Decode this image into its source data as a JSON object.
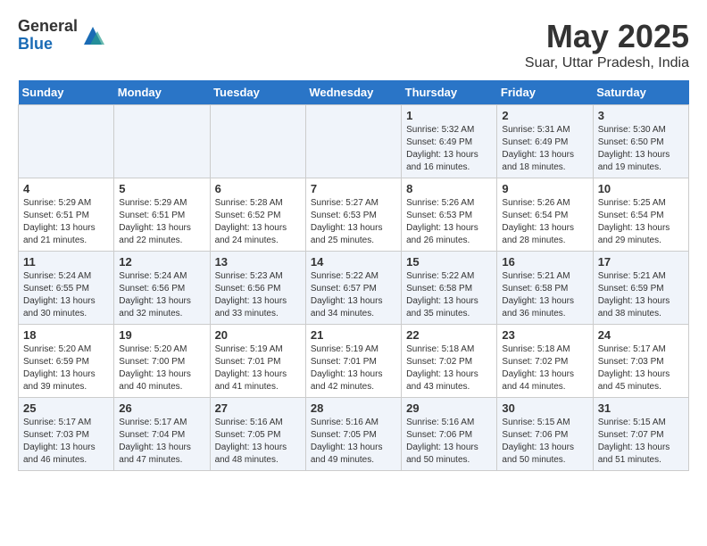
{
  "logo": {
    "general": "General",
    "blue": "Blue"
  },
  "title": "May 2025",
  "subtitle": "Suar, Uttar Pradesh, India",
  "days_of_week": [
    "Sunday",
    "Monday",
    "Tuesday",
    "Wednesday",
    "Thursday",
    "Friday",
    "Saturday"
  ],
  "weeks": [
    {
      "cells": [
        {
          "day": "",
          "info": ""
        },
        {
          "day": "",
          "info": ""
        },
        {
          "day": "",
          "info": ""
        },
        {
          "day": "",
          "info": ""
        },
        {
          "day": "1",
          "info": "Sunrise: 5:32 AM\nSunset: 6:49 PM\nDaylight: 13 hours\nand 16 minutes."
        },
        {
          "day": "2",
          "info": "Sunrise: 5:31 AM\nSunset: 6:49 PM\nDaylight: 13 hours\nand 18 minutes."
        },
        {
          "day": "3",
          "info": "Sunrise: 5:30 AM\nSunset: 6:50 PM\nDaylight: 13 hours\nand 19 minutes."
        }
      ]
    },
    {
      "cells": [
        {
          "day": "4",
          "info": "Sunrise: 5:29 AM\nSunset: 6:51 PM\nDaylight: 13 hours\nand 21 minutes."
        },
        {
          "day": "5",
          "info": "Sunrise: 5:29 AM\nSunset: 6:51 PM\nDaylight: 13 hours\nand 22 minutes."
        },
        {
          "day": "6",
          "info": "Sunrise: 5:28 AM\nSunset: 6:52 PM\nDaylight: 13 hours\nand 24 minutes."
        },
        {
          "day": "7",
          "info": "Sunrise: 5:27 AM\nSunset: 6:53 PM\nDaylight: 13 hours\nand 25 minutes."
        },
        {
          "day": "8",
          "info": "Sunrise: 5:26 AM\nSunset: 6:53 PM\nDaylight: 13 hours\nand 26 minutes."
        },
        {
          "day": "9",
          "info": "Sunrise: 5:26 AM\nSunset: 6:54 PM\nDaylight: 13 hours\nand 28 minutes."
        },
        {
          "day": "10",
          "info": "Sunrise: 5:25 AM\nSunset: 6:54 PM\nDaylight: 13 hours\nand 29 minutes."
        }
      ]
    },
    {
      "cells": [
        {
          "day": "11",
          "info": "Sunrise: 5:24 AM\nSunset: 6:55 PM\nDaylight: 13 hours\nand 30 minutes."
        },
        {
          "day": "12",
          "info": "Sunrise: 5:24 AM\nSunset: 6:56 PM\nDaylight: 13 hours\nand 32 minutes."
        },
        {
          "day": "13",
          "info": "Sunrise: 5:23 AM\nSunset: 6:56 PM\nDaylight: 13 hours\nand 33 minutes."
        },
        {
          "day": "14",
          "info": "Sunrise: 5:22 AM\nSunset: 6:57 PM\nDaylight: 13 hours\nand 34 minutes."
        },
        {
          "day": "15",
          "info": "Sunrise: 5:22 AM\nSunset: 6:58 PM\nDaylight: 13 hours\nand 35 minutes."
        },
        {
          "day": "16",
          "info": "Sunrise: 5:21 AM\nSunset: 6:58 PM\nDaylight: 13 hours\nand 36 minutes."
        },
        {
          "day": "17",
          "info": "Sunrise: 5:21 AM\nSunset: 6:59 PM\nDaylight: 13 hours\nand 38 minutes."
        }
      ]
    },
    {
      "cells": [
        {
          "day": "18",
          "info": "Sunrise: 5:20 AM\nSunset: 6:59 PM\nDaylight: 13 hours\nand 39 minutes."
        },
        {
          "day": "19",
          "info": "Sunrise: 5:20 AM\nSunset: 7:00 PM\nDaylight: 13 hours\nand 40 minutes."
        },
        {
          "day": "20",
          "info": "Sunrise: 5:19 AM\nSunset: 7:01 PM\nDaylight: 13 hours\nand 41 minutes."
        },
        {
          "day": "21",
          "info": "Sunrise: 5:19 AM\nSunset: 7:01 PM\nDaylight: 13 hours\nand 42 minutes."
        },
        {
          "day": "22",
          "info": "Sunrise: 5:18 AM\nSunset: 7:02 PM\nDaylight: 13 hours\nand 43 minutes."
        },
        {
          "day": "23",
          "info": "Sunrise: 5:18 AM\nSunset: 7:02 PM\nDaylight: 13 hours\nand 44 minutes."
        },
        {
          "day": "24",
          "info": "Sunrise: 5:17 AM\nSunset: 7:03 PM\nDaylight: 13 hours\nand 45 minutes."
        }
      ]
    },
    {
      "cells": [
        {
          "day": "25",
          "info": "Sunrise: 5:17 AM\nSunset: 7:03 PM\nDaylight: 13 hours\nand 46 minutes."
        },
        {
          "day": "26",
          "info": "Sunrise: 5:17 AM\nSunset: 7:04 PM\nDaylight: 13 hours\nand 47 minutes."
        },
        {
          "day": "27",
          "info": "Sunrise: 5:16 AM\nSunset: 7:05 PM\nDaylight: 13 hours\nand 48 minutes."
        },
        {
          "day": "28",
          "info": "Sunrise: 5:16 AM\nSunset: 7:05 PM\nDaylight: 13 hours\nand 49 minutes."
        },
        {
          "day": "29",
          "info": "Sunrise: 5:16 AM\nSunset: 7:06 PM\nDaylight: 13 hours\nand 50 minutes."
        },
        {
          "day": "30",
          "info": "Sunrise: 5:15 AM\nSunset: 7:06 PM\nDaylight: 13 hours\nand 50 minutes."
        },
        {
          "day": "31",
          "info": "Sunrise: 5:15 AM\nSunset: 7:07 PM\nDaylight: 13 hours\nand 51 minutes."
        }
      ]
    }
  ]
}
